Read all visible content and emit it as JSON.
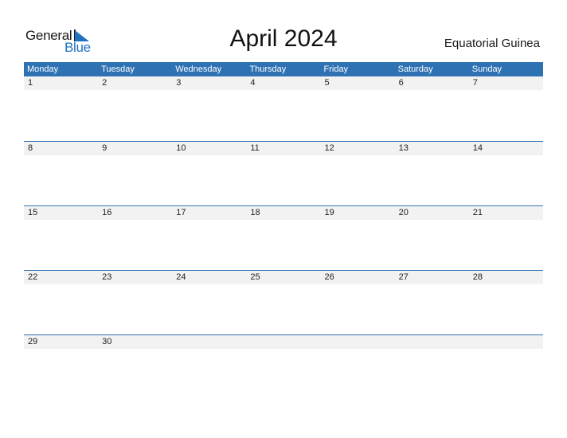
{
  "logo": {
    "word1": "General",
    "word2": "Blue"
  },
  "title": "April 2024",
  "country": "Equatorial Guinea",
  "colors": {
    "header_bg": "#2e72b4",
    "strip_bg": "#f2f2f2",
    "logo_blue": "#2171c1"
  },
  "weekdays": [
    "Monday",
    "Tuesday",
    "Wednesday",
    "Thursday",
    "Friday",
    "Saturday",
    "Sunday"
  ],
  "weeks": [
    [
      "1",
      "2",
      "3",
      "4",
      "5",
      "6",
      "7"
    ],
    [
      "8",
      "9",
      "10",
      "11",
      "12",
      "13",
      "14"
    ],
    [
      "15",
      "16",
      "17",
      "18",
      "19",
      "20",
      "21"
    ],
    [
      "22",
      "23",
      "24",
      "25",
      "26",
      "27",
      "28"
    ],
    [
      "29",
      "30",
      "",
      "",
      "",
      "",
      ""
    ]
  ]
}
